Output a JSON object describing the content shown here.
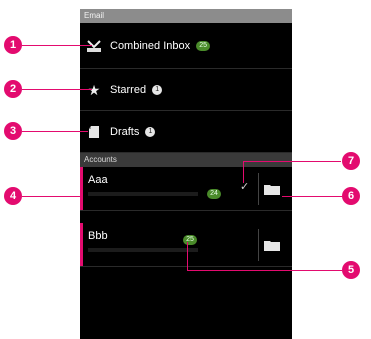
{
  "statusbar": {
    "title": "Email"
  },
  "menu": [
    {
      "label": "Combined Inbox",
      "badge": "25",
      "badge_style": "green",
      "icon": "inbox-icon"
    },
    {
      "label": "Starred",
      "badge": "1",
      "badge_style": "white",
      "icon": "star-icon"
    },
    {
      "label": "Drafts",
      "badge": "1",
      "badge_style": "white",
      "icon": "drafts-icon"
    }
  ],
  "accounts_header": "Accounts",
  "accounts": [
    {
      "name": "Aaa",
      "count": "24",
      "checked": true,
      "icon": "folder-icon"
    },
    {
      "name": "Bbb",
      "count": "25",
      "checked": false,
      "icon": "folder-icon"
    }
  ],
  "markers": [
    "1",
    "2",
    "3",
    "4",
    "5",
    "6",
    "7"
  ],
  "colors": {
    "accent": "#e30b6f",
    "badge_green": "#4a8b2a",
    "background": "#000000",
    "statusbar": "#8c8c8c"
  }
}
